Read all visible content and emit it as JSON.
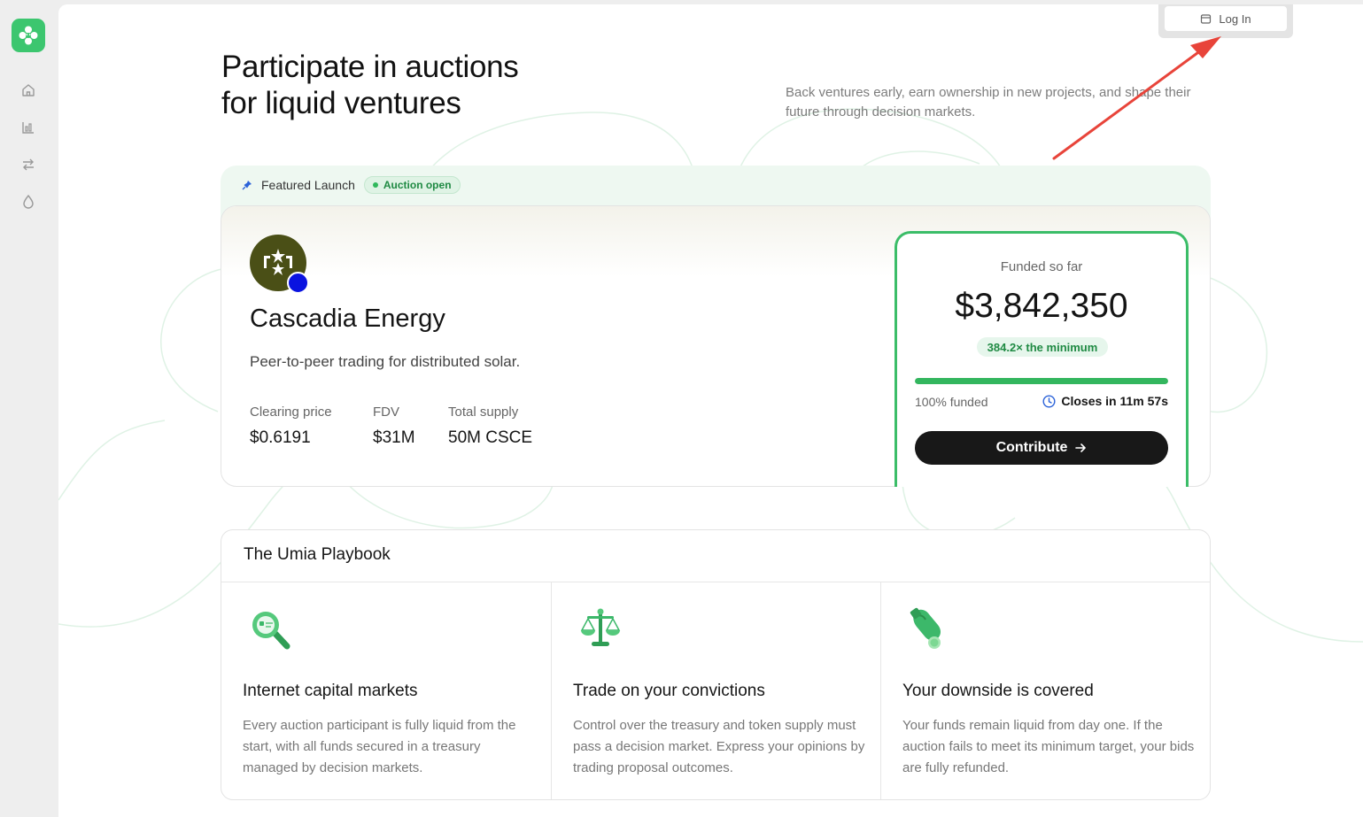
{
  "app": {
    "brand_color": "#3cc66f",
    "nav_icons": [
      "home-icon",
      "chart-icon",
      "swap-icon",
      "drop-icon"
    ]
  },
  "header": {
    "login_label": "Log In",
    "title_line1": "Participate in auctions",
    "title_line2": "for liquid ventures",
    "subtitle": "Back ventures early, earn ownership in new projects, and shape their future through decision markets."
  },
  "featured": {
    "label": "Featured Launch",
    "status": "Auction open",
    "project": {
      "name": "Cascadia Energy",
      "description": "Peer-to-peer trading for distributed solar.",
      "stats": [
        {
          "label": "Clearing price",
          "value": "$0.6191"
        },
        {
          "label": "FDV",
          "value": "$31M"
        },
        {
          "label": "Total supply",
          "value": "50M CSCE"
        }
      ]
    },
    "funding": {
      "label": "Funded so far",
      "amount": "$3,842,350",
      "multiple": "384.2× the minimum",
      "progress_fraction": 1.0,
      "percent_label": "100% funded",
      "closes": "Closes in 11m 57s",
      "cta": "Contribute",
      "accent": "#3bbd68"
    }
  },
  "playbook": {
    "title": "The Umia Playbook",
    "items": [
      {
        "icon": "magnifier-icon",
        "heading": "Internet capital markets",
        "text": "Every auction participant is fully liquid from the start, with all funds secured in a treasury managed by decision markets."
      },
      {
        "icon": "scales-icon",
        "heading": "Trade on your convictions",
        "text": "Control over the treasury and token supply must pass a decision market. Express your opinions by trading proposal outcomes."
      },
      {
        "icon": "hand-coin-icon",
        "heading": "Your downside is covered",
        "text": "Your funds remain liquid from day one. If the auction fails to meet its minimum target, your bids are fully refunded."
      }
    ]
  }
}
